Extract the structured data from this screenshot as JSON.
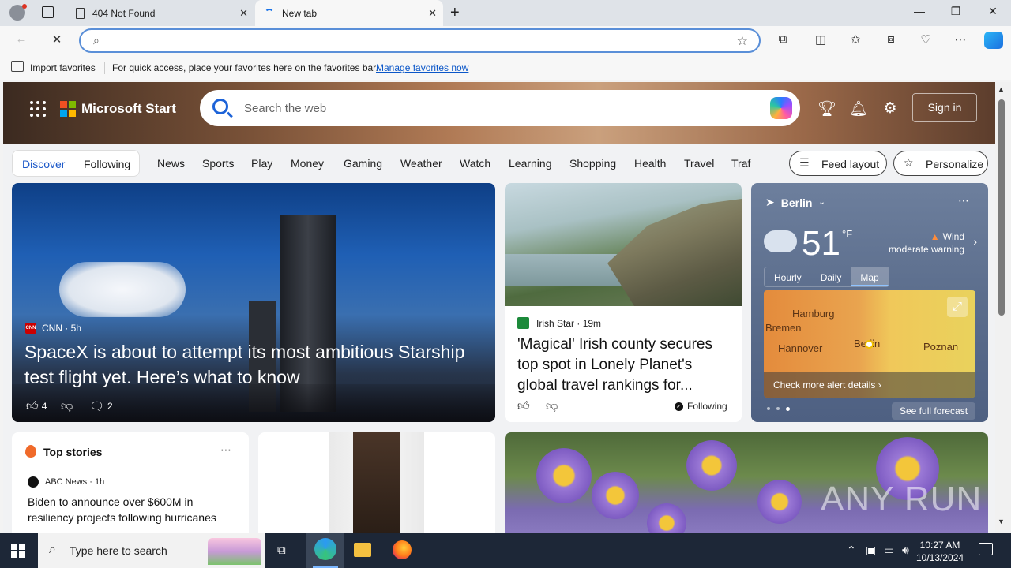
{
  "browser": {
    "tabs": [
      {
        "title": "404 Not Found",
        "active": false
      },
      {
        "title": "New tab",
        "active": true
      }
    ],
    "address_value": "",
    "favorites_bar": {
      "import_label": "Import favorites",
      "hint": "For quick access, place your favorites here on the favorites bar.",
      "manage_link": "Manage favorites now"
    }
  },
  "start_page": {
    "brand": "Microsoft Start",
    "search_placeholder": "Search the web",
    "sign_in": "Sign in",
    "feed_tabs": [
      "Discover",
      "Following"
    ],
    "nav_links": [
      "News",
      "Sports",
      "Play",
      "Money",
      "Gaming",
      "Weather",
      "Watch",
      "Learning",
      "Shopping",
      "Health",
      "Travel",
      "Traf"
    ],
    "feed_layout": "Feed layout",
    "personalize": "Personalize",
    "hero_card": {
      "source": "CNN",
      "source_logo": "CNN",
      "age": "5h",
      "headline": "SpaceX is about to attempt its most ambitious Starship test flight yet. Here’s what to know",
      "likes": "4",
      "comments": "2"
    },
    "second_card": {
      "source": "Irish Star",
      "age": "19m",
      "headline": "'Magical' Irish county secures top spot in Lonely Planet's global travel rankings for...",
      "following": "Following"
    },
    "weather": {
      "city": "Berlin",
      "temperature": "51",
      "unit": "°F",
      "alert_title": "Wind",
      "alert_detail": "moderate warning",
      "tabs": [
        "Hourly",
        "Daily",
        "Map"
      ],
      "active_tab": "Map",
      "map_labels": [
        "Hamburg",
        "Bremen",
        "Hannover",
        "Berlin",
        "Poznan"
      ],
      "check_alerts": "Check more alert details",
      "see_forecast": "See full forecast"
    },
    "top_stories": {
      "title": "Top stories",
      "source": "ABC News",
      "age": "1h",
      "headline": "Biden to announce over $600M in resiliency projects following hurricanes"
    },
    "watermark": "ANY RUN"
  },
  "taskbar": {
    "search_placeholder": "Type here to search",
    "time": "10:27 AM",
    "date": "10/13/2024"
  }
}
